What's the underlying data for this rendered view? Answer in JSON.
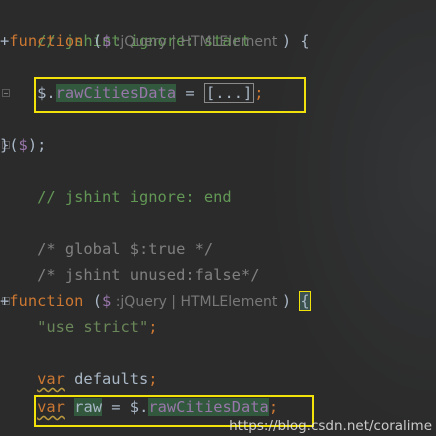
{
  "code": {
    "line1": "// jshint ignore: start",
    "line2_plus": "+",
    "line2_function": "function",
    "line2_open": " (",
    "line2_param": "$",
    "line2_hint": " :jQuery | HTMLElement ",
    "line2_close": ") {",
    "line4_indent": "    ",
    "line4_dollar": "$",
    "line4_dot": ".",
    "line4_prop": "rawCitiesData",
    "line4_eq": " = ",
    "line4_folded": "[...]",
    "line4_semi": ";",
    "line6_close": "}(",
    "line6_dollar": "$",
    "line6_end": ");",
    "line7": "// jshint ignore: end",
    "line9": "/* global $:true */",
    "line10": "/* jshint unused:false*/",
    "line12_plus": "+",
    "line12_function": "function",
    "line12_open": " (",
    "line12_param": "$",
    "line12_hint": " :jQuery | HTMLElement ",
    "line12_close": ") ",
    "line12_brace": "{",
    "line13_indent": "    ",
    "line13_str": "\"use strict\"",
    "line13_semi": ";",
    "line15_indent": "    ",
    "line15_var": "var",
    "line15_name": " defaults",
    "line15_semi": ";",
    "line16_indent": "    ",
    "line16_var": "var",
    "line16_sp": " ",
    "line16_name": "raw",
    "line16_eq": " = ",
    "line16_dollar": "$",
    "line16_dot": ".",
    "line16_prop": "rawCitiesData",
    "line16_semi": ";"
  },
  "watermark": "https://blog.csdn.net/coralime",
  "colors": {
    "background": "#2b2b2b",
    "comment": "#629755",
    "keyword": "#cc7832",
    "string": "#6a8759",
    "highlight_box": "#f2e20a",
    "identifier_highlight": "#32593d"
  }
}
